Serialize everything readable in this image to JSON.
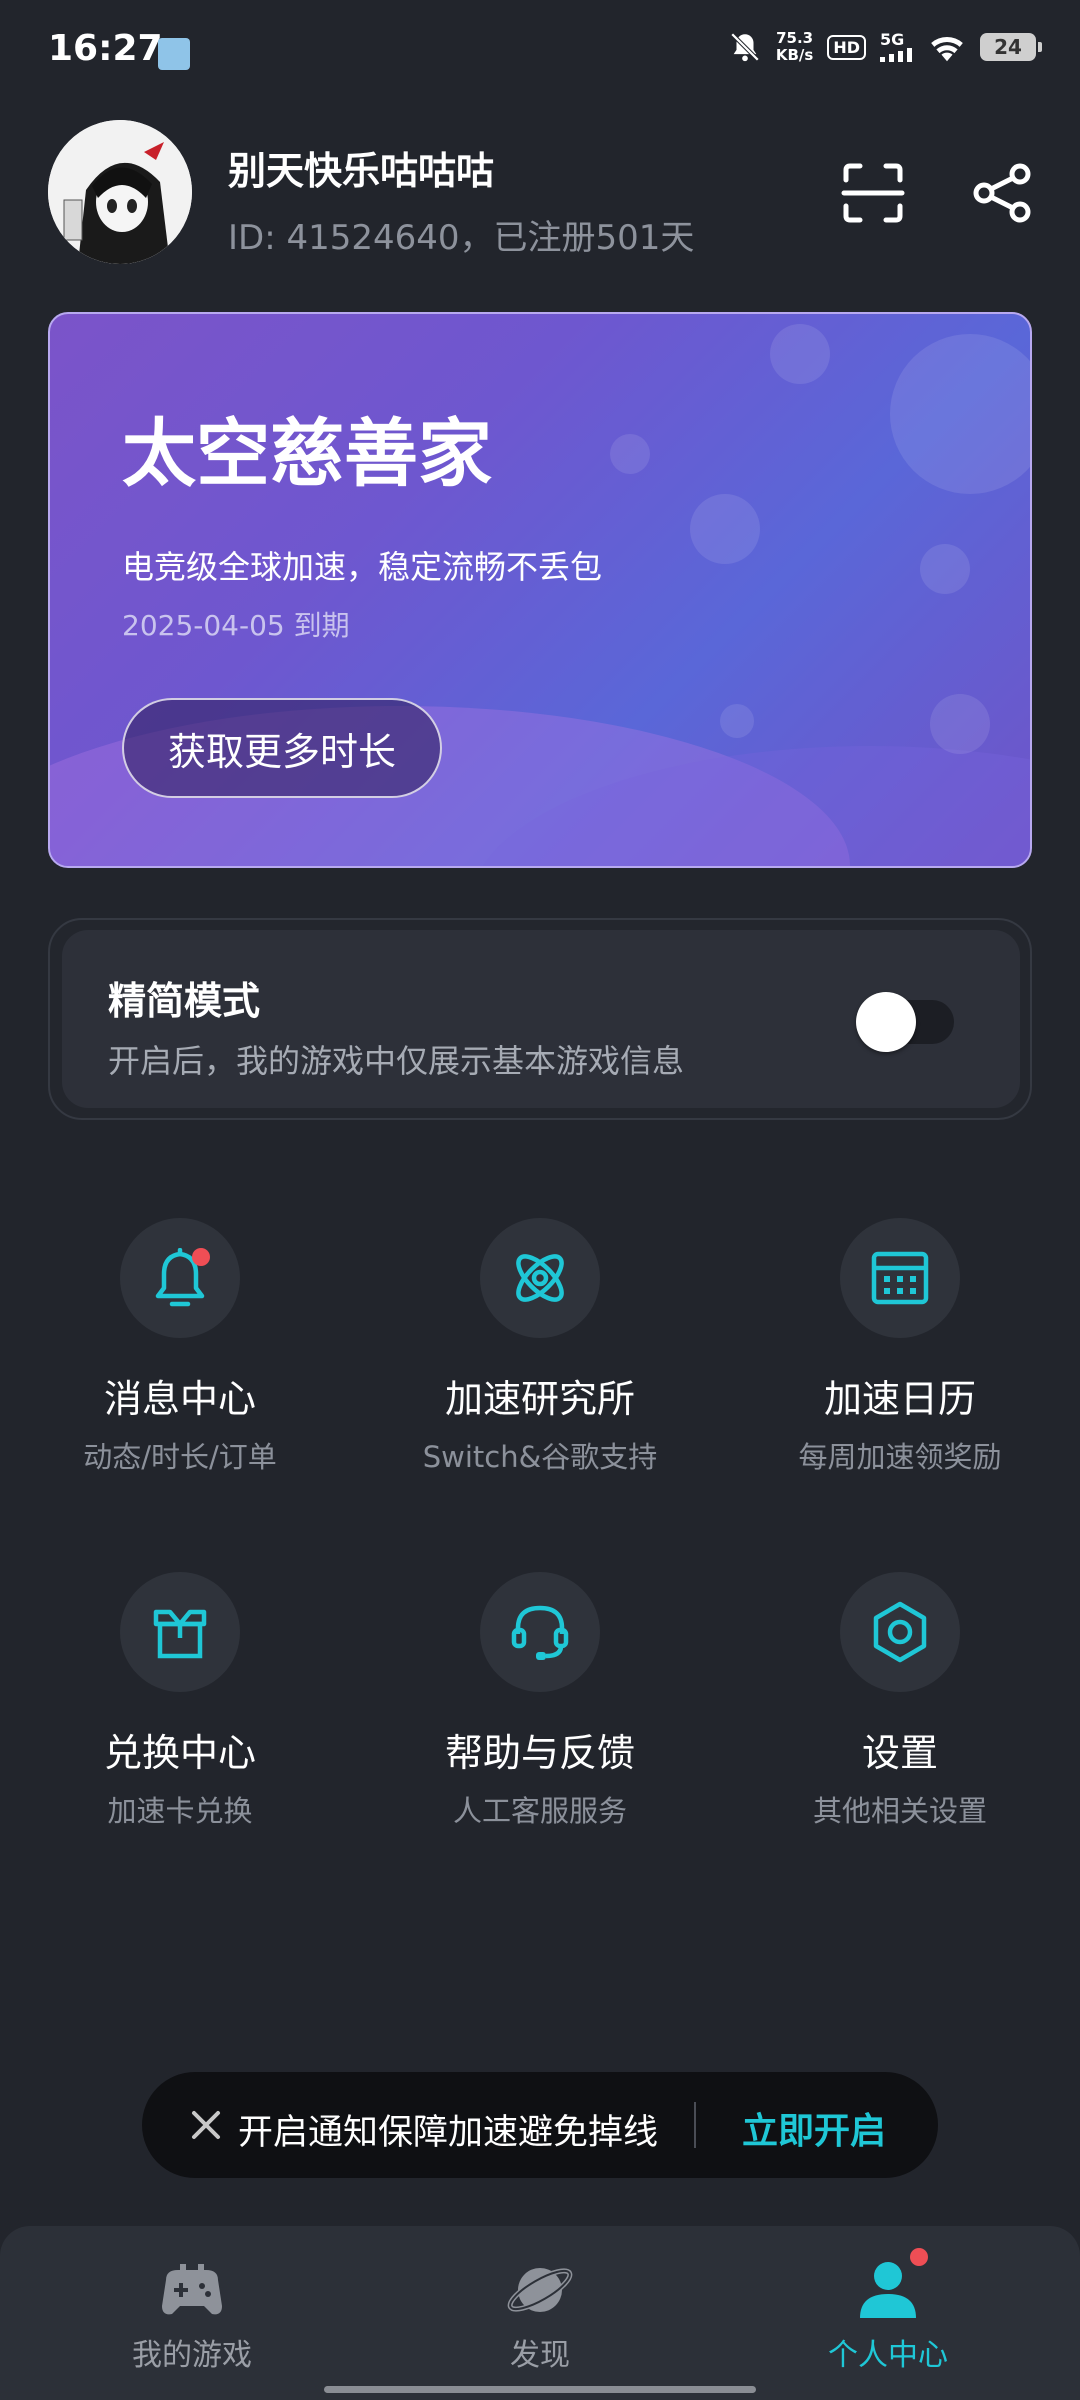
{
  "status_bar": {
    "time": "16:27",
    "net_speed_value": "75.3",
    "net_speed_unit": "KB/s",
    "hd": "HD",
    "network": "5G",
    "battery": "24"
  },
  "profile": {
    "username": "别天快乐咕咕咕",
    "id_line": "ID: 41524640，已注册501天"
  },
  "vip_card": {
    "title": "太空慈善家",
    "description": "电竞级全球加速，稳定流畅不丢包",
    "expire": "2025-04-05 到期",
    "button": "获取更多时长"
  },
  "simple_mode": {
    "title": "精简模式",
    "description": "开启后，我的游戏中仅展示基本游戏信息",
    "enabled": false
  },
  "grid": [
    {
      "title": "消息中心",
      "subtitle": "动态/时长/订单",
      "icon": "bell-icon"
    },
    {
      "title": "加速研究所",
      "subtitle": "Switch&谷歌支持",
      "icon": "atom-icon"
    },
    {
      "title": "加速日历",
      "subtitle": "每周加速领奖励",
      "icon": "calendar-icon"
    },
    {
      "title": "兑换中心",
      "subtitle": "加速卡兑换",
      "icon": "gift-box-icon"
    },
    {
      "title": "帮助与反馈",
      "subtitle": "人工客服服务",
      "icon": "headset-icon"
    },
    {
      "title": "设置",
      "subtitle": "其他相关设置",
      "icon": "settings-icon"
    }
  ],
  "notify_bar": {
    "text": "开启通知保障加速避免掉线",
    "action": "立即开启"
  },
  "bottom_nav": [
    {
      "label": "我的游戏",
      "icon": "gamepad-icon"
    },
    {
      "label": "发现",
      "icon": "planet-icon"
    },
    {
      "label": "个人中心",
      "icon": "person-icon",
      "active": true
    }
  ],
  "colors": {
    "background": "#22252c",
    "accent": "#1fc7d6",
    "badge": "#ef4e55",
    "card_gradient_start": "#7b54c9",
    "card_gradient_end": "#5a67d8"
  }
}
